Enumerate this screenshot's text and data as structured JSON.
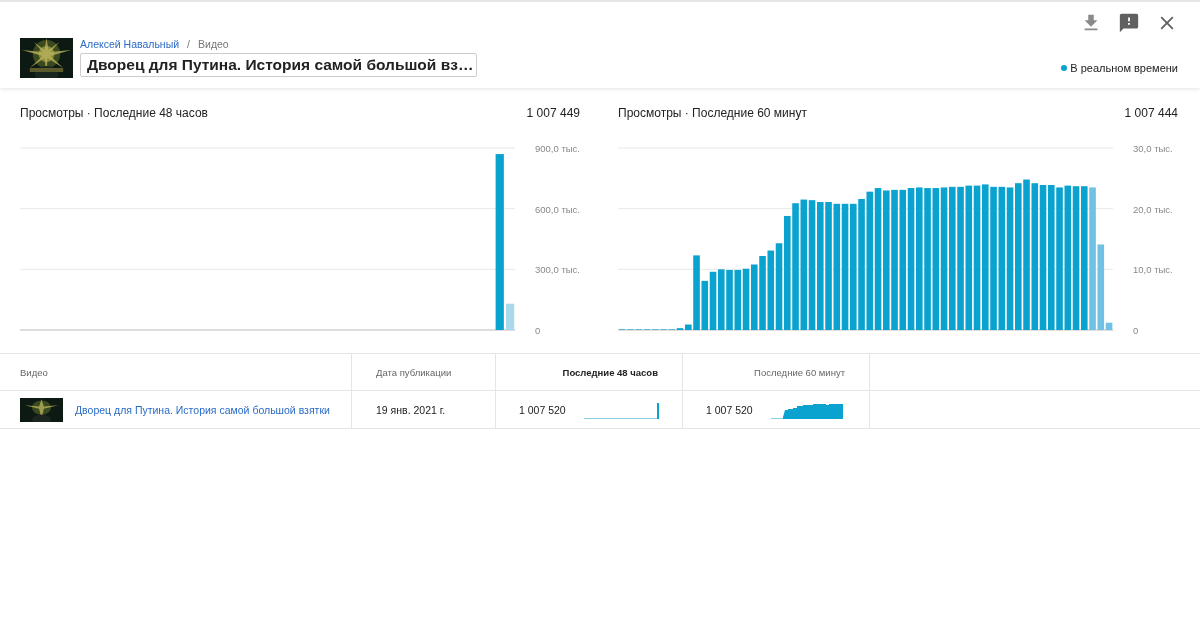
{
  "header": {
    "channel": "Алексей Навальный",
    "separator": "/",
    "section": "Видео",
    "search": {
      "value": "Дворец для Путина. История самой большой вз…"
    },
    "realtime": "В реальном времени"
  },
  "panels": [
    {
      "title": "Просмотры · Последние 48 часов",
      "total": "1 007 449",
      "chart_data": {
        "type": "bar",
        "ylim": [
          0,
          900
        ],
        "yticks": [
          {
            "value": 0,
            "label": "0"
          },
          {
            "value": 300,
            "label": "300,0 тыс."
          },
          {
            "value": 600,
            "label": "600,0 тыс."
          },
          {
            "value": 900,
            "label": "900,0 тыс."
          }
        ],
        "series": [
          {
            "color": "#0aa3cf",
            "values": [
              0,
              0,
              0,
              0,
              0,
              0,
              0,
              0,
              0,
              0,
              0,
              0,
              0,
              0,
              0,
              0,
              0,
              0,
              0,
              0,
              0,
              0,
              0,
              0,
              0,
              0,
              0,
              0,
              0,
              0,
              0,
              0,
              0,
              0,
              0,
              0,
              0,
              0,
              0,
              0,
              0,
              0,
              0,
              0,
              0,
              0,
              870,
              null
            ]
          },
          {
            "color": "#a9d9ed",
            "values": [
              null,
              null,
              null,
              null,
              null,
              null,
              null,
              null,
              null,
              null,
              null,
              null,
              null,
              null,
              null,
              null,
              null,
              null,
              null,
              null,
              null,
              null,
              null,
              null,
              null,
              null,
              null,
              null,
              null,
              null,
              null,
              null,
              null,
              null,
              null,
              null,
              null,
              null,
              null,
              null,
              null,
              null,
              null,
              null,
              null,
              null,
              null,
              130
            ]
          }
        ]
      }
    },
    {
      "title": "Просмотры · Последние 60 минут",
      "total": "1 007 444",
      "chart_data": {
        "type": "bar",
        "ylim": [
          0,
          30
        ],
        "yticks": [
          {
            "value": 0,
            "label": "0"
          },
          {
            "value": 10,
            "label": "10,0 тыс."
          },
          {
            "value": 20,
            "label": "20,0 тыс."
          },
          {
            "value": 30,
            "label": "30,0 тыс."
          }
        ],
        "series": [
          {
            "color": "#0aa3cf",
            "values": [
              0.1,
              0.1,
              0.1,
              0.1,
              0.1,
              0.1,
              0.1,
              0.3,
              0.9,
              12.3,
              8.1,
              9.6,
              10,
              9.9,
              9.9,
              10.1,
              10.8,
              12.2,
              13.1,
              14.3,
              18.8,
              20.9,
              21.5,
              21.4,
              21.1,
              21.1,
              20.8,
              20.8,
              20.8,
              21.6,
              22.8,
              23.4,
              23,
              23.1,
              23.1,
              23.4,
              23.5,
              23.4,
              23.4,
              23.5,
              23.6,
              23.6,
              23.8,
              23.8,
              24,
              23.6,
              23.6,
              23.5,
              24.2,
              24.8,
              24.2,
              23.9,
              23.9,
              23.5,
              23.8,
              23.7,
              23.7,
              null,
              null,
              null
            ]
          },
          {
            "color": "#6fc2e3",
            "values": [
              null,
              null,
              null,
              null,
              null,
              null,
              null,
              null,
              null,
              null,
              null,
              null,
              null,
              null,
              null,
              null,
              null,
              null,
              null,
              null,
              null,
              null,
              null,
              null,
              null,
              null,
              null,
              null,
              null,
              null,
              null,
              null,
              null,
              null,
              null,
              null,
              null,
              null,
              null,
              null,
              null,
              null,
              null,
              null,
              null,
              null,
              null,
              null,
              null,
              null,
              null,
              null,
              null,
              null,
              null,
              null,
              null,
              23.5,
              14.1,
              1.2
            ]
          }
        ]
      }
    }
  ],
  "table": {
    "columns": [
      {
        "label": "Видео",
        "sorted": false
      },
      {
        "label": "Дата публикации",
        "sorted": false
      },
      {
        "label": "Последние 48 часов",
        "sorted": true
      },
      {
        "label": "Последние 60 минут",
        "sorted": false
      }
    ],
    "rows": [
      {
        "title": "Дворец для Путина. История самой большой взятки",
        "date": "19 янв. 2021 г.",
        "views_48h": "1 007 520",
        "views_60m": "1 007 520"
      }
    ]
  }
}
